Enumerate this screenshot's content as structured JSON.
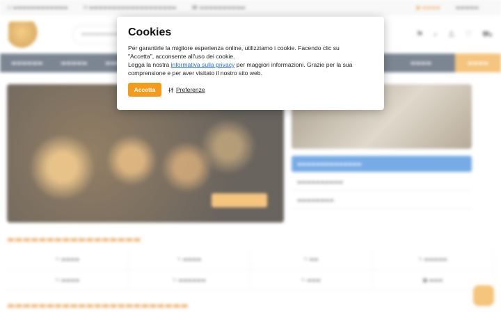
{
  "cookie_modal": {
    "title": "Cookies",
    "line1": "Per garantirle la migliore esperienza online, utilizziamo i cookie. Facendo clic su",
    "line2": "\"Accetta\", acconsente all'uso dei cookie.",
    "line3_pre": "Legga la nostra ",
    "privacy_link": "informativa sulla privacy",
    "line3_post": " per maggiori informazioni. Grazie per la sua",
    "line4": "comprensione e per aver visitato il nostro sito web.",
    "accept_label": "Accetta",
    "preferences_label": "Preferenze",
    "accent_color": "#f39c1b",
    "link_color": "#2a6fd6"
  }
}
